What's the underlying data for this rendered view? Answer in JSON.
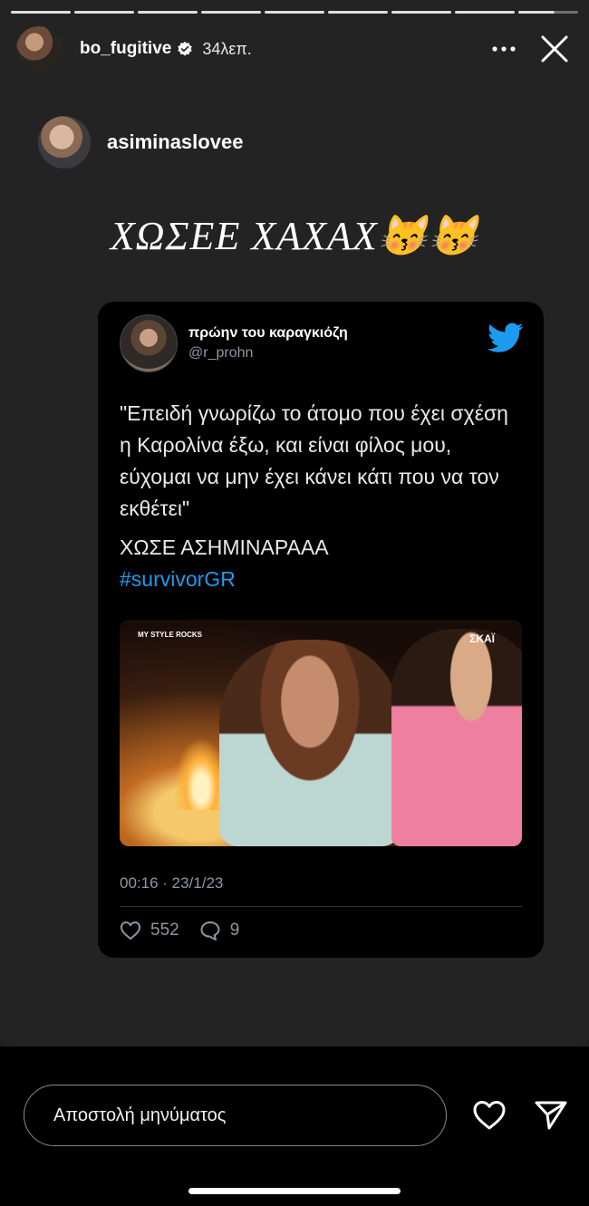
{
  "story": {
    "author": "bo_fugitive",
    "time_ago": "34λεπ.",
    "more_label": "•••",
    "progress_segments": 9
  },
  "repost": {
    "username": "asiminaslovee"
  },
  "caption": {
    "text": "ΧΩΣΕΕ ΧΑΧΑΧ😽😽"
  },
  "tweet": {
    "display_name": "πρώην του καραγκιόζη",
    "handle": "@r_prohn",
    "text_quote": "\"Επειδή γνωρίζω το άτομο που έχει σχέση η Καρολίνα έξω, και είναι φίλος μου, εύχομαι να μην έχει κάνει κάτι που να τον εκθέτει\"",
    "text_line2": "ΧΩΣΕ ΑΣΗΜΙΝΑΡΑΑΑ",
    "hashtag": "#survivorGR",
    "media_logo_left": "MY STYLE ROCKS",
    "media_logo_right": "ΣΚΑΪ",
    "timestamp": "00:16 · 23/1/23",
    "likes": "552",
    "replies": "9"
  },
  "bottom": {
    "message_placeholder": "Αποστολή μηνύματος"
  },
  "colors": {
    "twitter_blue": "#1d9bf0",
    "story_bg": "#232323"
  }
}
